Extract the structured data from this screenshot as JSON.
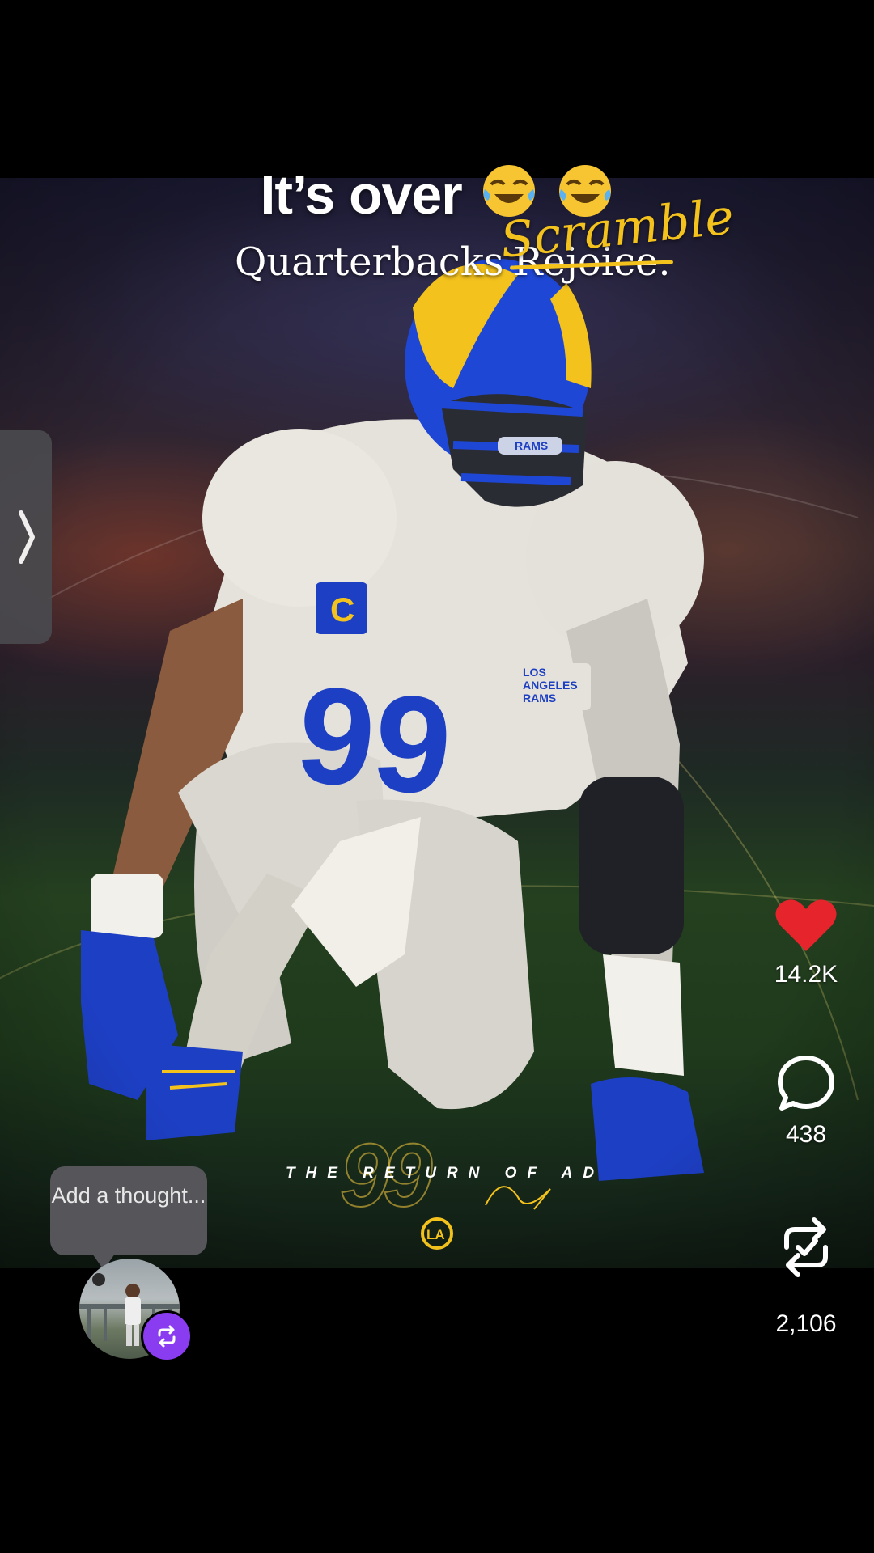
{
  "caption": {
    "text": "It’s over",
    "emoji": [
      "face-with-tears-of-joy",
      "face-with-tears-of-joy"
    ]
  },
  "poster": {
    "headline_word": "Quarterbacks",
    "struck_word": "Rejoice.",
    "handwritten_word": "Scramble",
    "jersey_number": "99",
    "tagline": "THE RETURN OF AD",
    "logo": "rams-logo",
    "team_text": "LOS ANGELES RAMS",
    "helmet_text": "RAMS"
  },
  "actions": {
    "like": {
      "icon": "heart-icon",
      "count": "14.2K",
      "color": "#e5242c",
      "liked": true
    },
    "comment": {
      "icon": "comment-bubble-icon",
      "count": "438"
    },
    "repost": {
      "icon": "repost-check-icon",
      "count": "2,106"
    }
  },
  "thought_bubble": {
    "placeholder": "Add a thought..."
  },
  "side_panel": {
    "icon": "chevron-right-icon"
  },
  "colors": {
    "accent_yellow": "#f3c21d",
    "repost_badge": "#8a3cf0",
    "rams_blue": "#1d3fc4"
  }
}
